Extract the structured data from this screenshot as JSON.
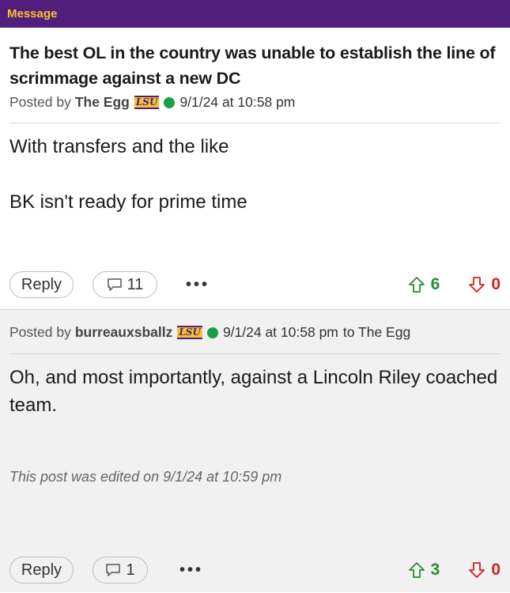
{
  "header": {
    "label": "Message"
  },
  "post1": {
    "title": "The best OL in the country was unable to establish the line of scrimmage against a new DC",
    "posted_by_label": "Posted by",
    "author": "The Egg",
    "badge": "LSU",
    "timestamp": "9/1/24 at 10:58 pm",
    "body": [
      "With transfers and the like",
      "BK isn't ready for prime time"
    ],
    "reply_label": "Reply",
    "comment_count": "11",
    "more": "•••",
    "upvotes": "6",
    "downvotes": "0"
  },
  "post2": {
    "posted_by_label": "Posted by",
    "author": "burreauxsballz",
    "badge": "LSU",
    "timestamp": "9/1/24 at 10:58 pm",
    "reply_to": "to The Egg",
    "body": "Oh, and most importantly, against a Lincoln Riley coached team.",
    "edited_note": "This post was edited on 9/1/24 at 10:59 pm",
    "reply_label": "Reply",
    "comment_count": "1",
    "more": "•••",
    "upvotes": "3",
    "downvotes": "0"
  },
  "colors": {
    "header_bg": "#521e7c",
    "header_text": "#f4c430",
    "online_dot": "#1a9e4a",
    "upvote": "#2e8b2e",
    "downvote": "#d42020"
  },
  "icons": [
    "comment-icon",
    "upvote-arrow-icon",
    "downvote-arrow-icon",
    "online-status-icon",
    "lsu-badge-icon"
  ]
}
